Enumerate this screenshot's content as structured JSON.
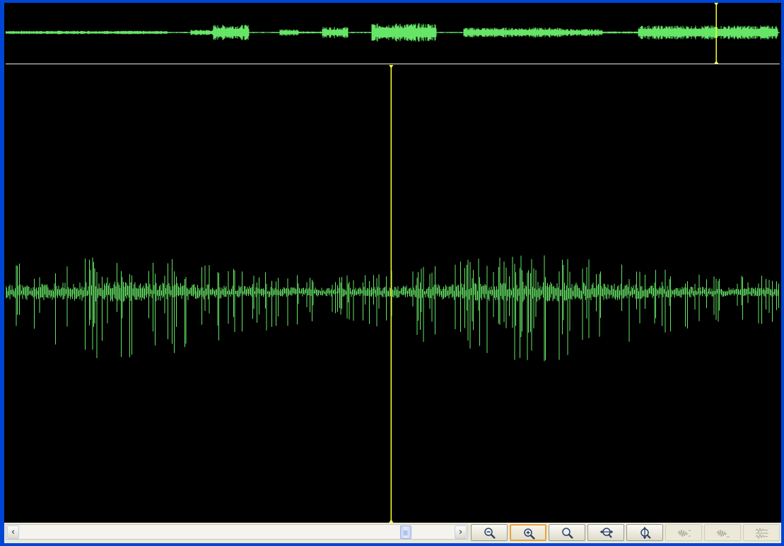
{
  "colors": {
    "waveform": "#66e566",
    "cursor": "#ffff33",
    "background": "#000000",
    "window_frame": "#0046d5"
  },
  "overview": {
    "cursor_position": 0.918
  },
  "main_view": {
    "cursor_position": 0.498
  },
  "scrollbar": {
    "thumb_position": 0.895
  },
  "toolbar": {
    "buttons": [
      {
        "icon": "zoom-out-icon",
        "state": "normal"
      },
      {
        "icon": "zoom-in-icon",
        "state": "active"
      },
      {
        "icon": "zoom-fit-icon",
        "state": "normal"
      },
      {
        "icon": "zoom-horizontal-icon",
        "state": "normal"
      },
      {
        "icon": "zoom-vertical-icon",
        "state": "normal"
      },
      {
        "icon": "waveform-mode-1-icon",
        "state": "disabled"
      },
      {
        "icon": "waveform-mode-2-icon",
        "state": "disabled"
      },
      {
        "icon": "waveform-mode-3-icon",
        "state": "disabled"
      }
    ]
  }
}
